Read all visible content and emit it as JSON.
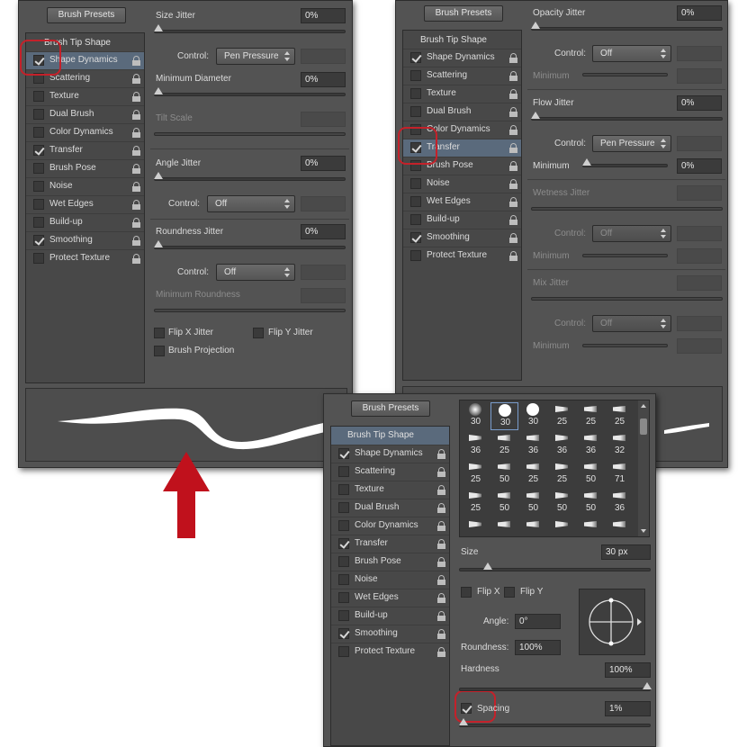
{
  "brush_presets_label": "Brush Presets",
  "brush_tip_shape": "Brush Tip Shape",
  "panel_list": [
    "Shape Dynamics",
    "Scattering",
    "Texture",
    "Dual Brush",
    "Color Dynamics",
    "Transfer",
    "Brush Pose",
    "Noise",
    "Wet Edges",
    "Build-up",
    "Smoothing",
    "Protect Texture"
  ],
  "left_checked": [
    true,
    false,
    false,
    false,
    false,
    true,
    false,
    false,
    false,
    false,
    true,
    false
  ],
  "right_checked": [
    true,
    false,
    false,
    false,
    false,
    true,
    false,
    false,
    false,
    false,
    true,
    false
  ],
  "bottom_checked": [
    true,
    false,
    false,
    false,
    false,
    true,
    false,
    false,
    false,
    false,
    true,
    false
  ],
  "shape_dynamics": {
    "size_jitter_label": "Size Jitter",
    "size_jitter": "0%",
    "control_label": "Control:",
    "control_value": "Pen Pressure",
    "min_diameter_label": "Minimum Diameter",
    "min_diameter": "0%",
    "tilt_scale_label": "Tilt Scale",
    "angle_jitter_label": "Angle Jitter",
    "angle_jitter": "0%",
    "angle_control": "Off",
    "roundness_jitter_label": "Roundness Jitter",
    "roundness_jitter": "0%",
    "roundness_control": "Off",
    "min_roundness_label": "Minimum Roundness",
    "flip_x_label": "Flip X Jitter",
    "flip_y_label": "Flip Y Jitter",
    "brush_projection_label": "Brush Projection"
  },
  "transfer": {
    "opacity_jitter_label": "Opacity Jitter",
    "opacity_jitter": "0%",
    "control_label": "Control:",
    "opacity_control": "Off",
    "minimum_label": "Minimum",
    "flow_jitter_label": "Flow Jitter",
    "flow_jitter": "0%",
    "flow_control": "Pen Pressure",
    "flow_minimum": "0%",
    "wetness_jitter_label": "Wetness Jitter",
    "wetness_control": "Off",
    "mix_jitter_label": "Mix Jitter",
    "mix_control": "Off"
  },
  "tip_shape": {
    "grid_sizes": [
      "30",
      "30",
      "30",
      "25",
      "25",
      "25",
      "36",
      "25",
      "36",
      "36",
      "36",
      "32",
      "25",
      "50",
      "25",
      "25",
      "50",
      "71",
      "25",
      "50",
      "50",
      "50",
      "50",
      "36",
      "",
      "",
      "",
      "",
      "",
      ""
    ],
    "size_label": "Size",
    "size_value": "30 px",
    "flip_x_label": "Flip X",
    "flip_y_label": "Flip Y",
    "angle_label": "Angle:",
    "angle_value": "0°",
    "roundness_label": "Roundness:",
    "roundness_value": "100%",
    "hardness_label": "Hardness",
    "hardness_value": "100%",
    "spacing_label": "Spacing",
    "spacing_value": "1%"
  },
  "colors": {
    "highlight": "#c4212a",
    "arrow": "#c0111c",
    "panel": "#535353"
  }
}
